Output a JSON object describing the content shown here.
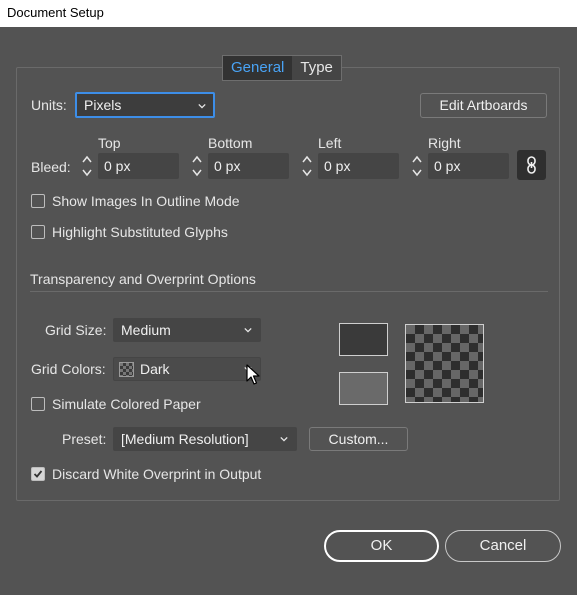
{
  "window": {
    "title": "Document Setup"
  },
  "tabs": [
    {
      "label": "General",
      "active": true
    },
    {
      "label": "Type",
      "active": false
    }
  ],
  "units": {
    "label": "Units:",
    "value": "Pixels"
  },
  "edit_artboards_label": "Edit Artboards",
  "bleed": {
    "label": "Bleed:",
    "top": {
      "label": "Top",
      "value": "0 px"
    },
    "bottom": {
      "label": "Bottom",
      "value": "0 px"
    },
    "left": {
      "label": "Left",
      "value": "0 px"
    },
    "right": {
      "label": "Right",
      "value": "0 px"
    },
    "link_icon": "link-icon"
  },
  "options": {
    "show_images_outline": {
      "label": "Show Images In Outline Mode",
      "checked": false
    },
    "highlight_glyphs": {
      "label": "Highlight Substituted Glyphs",
      "checked": false
    }
  },
  "transparency": {
    "section_title": "Transparency and Overprint Options",
    "grid_size": {
      "label": "Grid Size:",
      "value": "Medium"
    },
    "grid_colors": {
      "label": "Grid Colors:",
      "value": "Dark"
    },
    "simulate_paper": {
      "label": "Simulate Colored Paper",
      "checked": false
    },
    "preset": {
      "label": "Preset:",
      "value": "[Medium Resolution]"
    },
    "custom_label": "Custom...",
    "discard_white": {
      "label": "Discard White Overprint in Output",
      "checked": true
    },
    "colors": {
      "swatch_dark": "#3a3a3a",
      "swatch_light": "#6a6a6a"
    }
  },
  "buttons": {
    "ok": "OK",
    "cancel": "Cancel"
  },
  "colors": {
    "accent": "#49a3f5",
    "focus": "#3d8ee8",
    "bg": "#535353"
  }
}
